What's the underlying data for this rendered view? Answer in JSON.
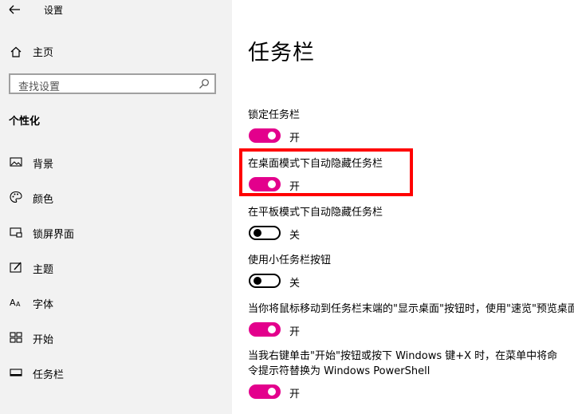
{
  "window": {
    "title": "设置"
  },
  "sidebar": {
    "home_label": "主页",
    "search_placeholder": "查找设置",
    "section_title": "个性化",
    "items": [
      {
        "label": "背景",
        "icon": "picture-icon"
      },
      {
        "label": "颜色",
        "icon": "palette-icon"
      },
      {
        "label": "锁屏界面",
        "icon": "lock-screen-icon"
      },
      {
        "label": "主题",
        "icon": "theme-icon"
      },
      {
        "label": "字体",
        "icon": "font-icon"
      },
      {
        "label": "开始",
        "icon": "start-icon"
      },
      {
        "label": "任务栏",
        "icon": "taskbar-icon",
        "active": true
      }
    ]
  },
  "main": {
    "title": "任务栏",
    "settings": [
      {
        "label": "锁定任务栏",
        "state": "开",
        "on": true
      },
      {
        "label": "在桌面模式下自动隐藏任务栏",
        "state": "开",
        "on": true,
        "highlighted": true
      },
      {
        "label": "在平板模式下自动隐藏任务栏",
        "state": "关",
        "on": false
      },
      {
        "label": "使用小任务栏按钮",
        "state": "关",
        "on": false
      },
      {
        "label": "当你将鼠标移动到任务栏末端的\"显示桌面\"按钮时，使用\"速览\"预览桌面",
        "state": "开",
        "on": true
      },
      {
        "label": "当我右键单击\"开始\"按钮或按下 Windows 键+X 时，在菜单中将命令提示符替换为 Windows PowerShell",
        "state": "开",
        "on": true
      }
    ]
  },
  "colors": {
    "accent": "#e3008c",
    "highlight": "#ff0000",
    "sidebar_bg": "#f2f2f2"
  }
}
